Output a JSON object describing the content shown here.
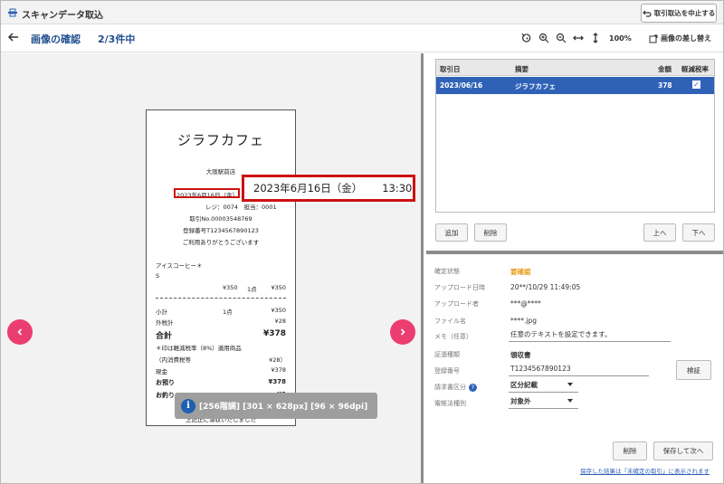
{
  "app": {
    "title": "スキャンデータ取込",
    "cancel_label": "取引取込を中止する"
  },
  "header": {
    "title": "画像の確認",
    "count": "2/3件中",
    "zoom": "100%",
    "replace_label": "画像の差し替え"
  },
  "receipt": {
    "store_name": "ジラフカフェ",
    "branch": "大阪駅前店",
    "date": "2023年6月16日（金）",
    "register": "レジ：0074　担当：0001",
    "transaction_no": "取引No.00003548769",
    "registration_no": "登録番号T1234567890123",
    "thanks": "ご利用ありがとうございます",
    "item_name": "アイスコーヒー＊",
    "item_size": "S",
    "item_price": "¥350",
    "item_qty": "1点",
    "item_total": "¥350",
    "subtotal_label": "小計",
    "subtotal_qty": "1点",
    "subtotal_value": "¥350",
    "tax_label": "外税計",
    "tax_value": "¥28",
    "total_label": "合計",
    "total_value": "¥378",
    "reduced_note": "＊印は軽減税率（8%）適用商品",
    "inner_tax_label": "（内消費税等",
    "inner_tax_value": "¥28）",
    "cash_label": "現金",
    "cash_value": "¥378",
    "deposit_label": "お預り",
    "deposit_value": "¥378",
    "change_label": "お釣り",
    "change_value": "¥0",
    "footer": "上記正に領収いたしました"
  },
  "callout": {
    "date": "2023年6月16日（金）",
    "time": "13:30"
  },
  "image_info": "[256階調] [301 × 628px] [96 × 96dpi]",
  "list": {
    "headers": {
      "date": "取引日",
      "summary": "摘要",
      "amount": "金額",
      "reduced": "軽減税率"
    },
    "row": {
      "date": "2023/06/16",
      "summary": "ジラフカフェ",
      "amount": "378",
      "reduced_check": "✓"
    },
    "add_label": "追加",
    "delete_label": "削除",
    "up_label": "上へ",
    "down_label": "下へ"
  },
  "details": {
    "status_label": "確定状態",
    "status_value": "要確認",
    "upload_date_label": "アップロード日時",
    "upload_date_value": "20**/10/29 11:49:05",
    "uploader_label": "アップロード者",
    "uploader_value": "***@****",
    "filename_label": "ファイル名",
    "filename_value": "****.jpg",
    "memo_label": "メモ（任意）",
    "memo_value": "任意のテキストを設定できます。",
    "doc_type_label": "証憑種類",
    "doc_type_value": "領収書",
    "reg_no_label": "登録番号",
    "reg_no_value": "T1234567890123",
    "verify_label": "検証",
    "invoice_class_label": "請求書区分",
    "invoice_class_value": "区分記載",
    "ebook_label": "電帳法種別",
    "ebook_value": "対象外",
    "delete_label": "削除",
    "save_next_label": "保存して次へ",
    "footer_note": "保存した結果は「未確定の取引」に表示されます"
  },
  "colors": {
    "accent": "#2f62b7",
    "title_blue": "#1f4f8f",
    "highlight_red": "#cc1111",
    "nav_pink": "#ec3d70",
    "status_orange": "#e89a1a"
  }
}
